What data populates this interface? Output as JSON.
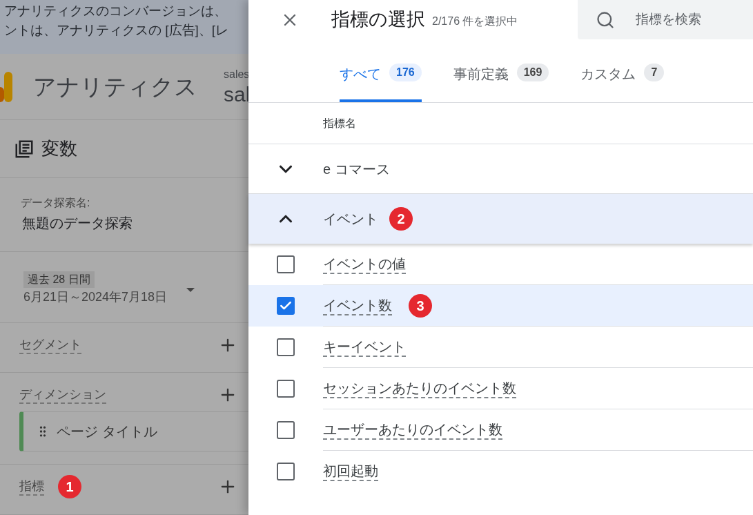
{
  "banner": {
    "lines": [
      "アナリティクスのコンバージョンは、",
      "ントは、アナリティクスの [広告]、[レ"
    ]
  },
  "header": {
    "product": "アナリティクス",
    "account_label": "sales",
    "account_name": "sal"
  },
  "variables_panel": {
    "title": "変数",
    "exploration": {
      "label": "データ探索名:",
      "value": "無題のデータ探索"
    },
    "date": {
      "badge": "過去 28 日間",
      "range": "6月21日～2024年7月18日"
    },
    "sections": [
      {
        "label": "セグメント"
      },
      {
        "label": "ディメンション",
        "items": [
          {
            "label": "ページ タイトル"
          }
        ]
      },
      {
        "label": "指標",
        "badge": "1"
      }
    ]
  },
  "dialog": {
    "title": "指標の選択",
    "count": "2/176 件を選択中",
    "search": {
      "placeholder": "指標を検索"
    },
    "tabs": [
      {
        "label": "すべて",
        "count": "176",
        "selected": true
      },
      {
        "label": "事前定義",
        "count": "169",
        "selected": false
      },
      {
        "label": "カスタム",
        "count": "7",
        "selected": false
      }
    ],
    "column_header": "指標名",
    "groups": [
      {
        "label": "e コマース",
        "expanded": false
      },
      {
        "label": "イベント",
        "expanded": true,
        "badge": "2",
        "children": [
          {
            "label": "イベントの値",
            "checked": false
          },
          {
            "label": "イベント数",
            "checked": true,
            "badge": "3"
          },
          {
            "label": "キーイベント",
            "checked": false
          },
          {
            "label": "セッションあたりのイベント数",
            "checked": false
          },
          {
            "label": "ユーザーあたりのイベント数",
            "checked": false
          },
          {
            "label": "初回起動",
            "checked": false
          }
        ]
      }
    ]
  }
}
